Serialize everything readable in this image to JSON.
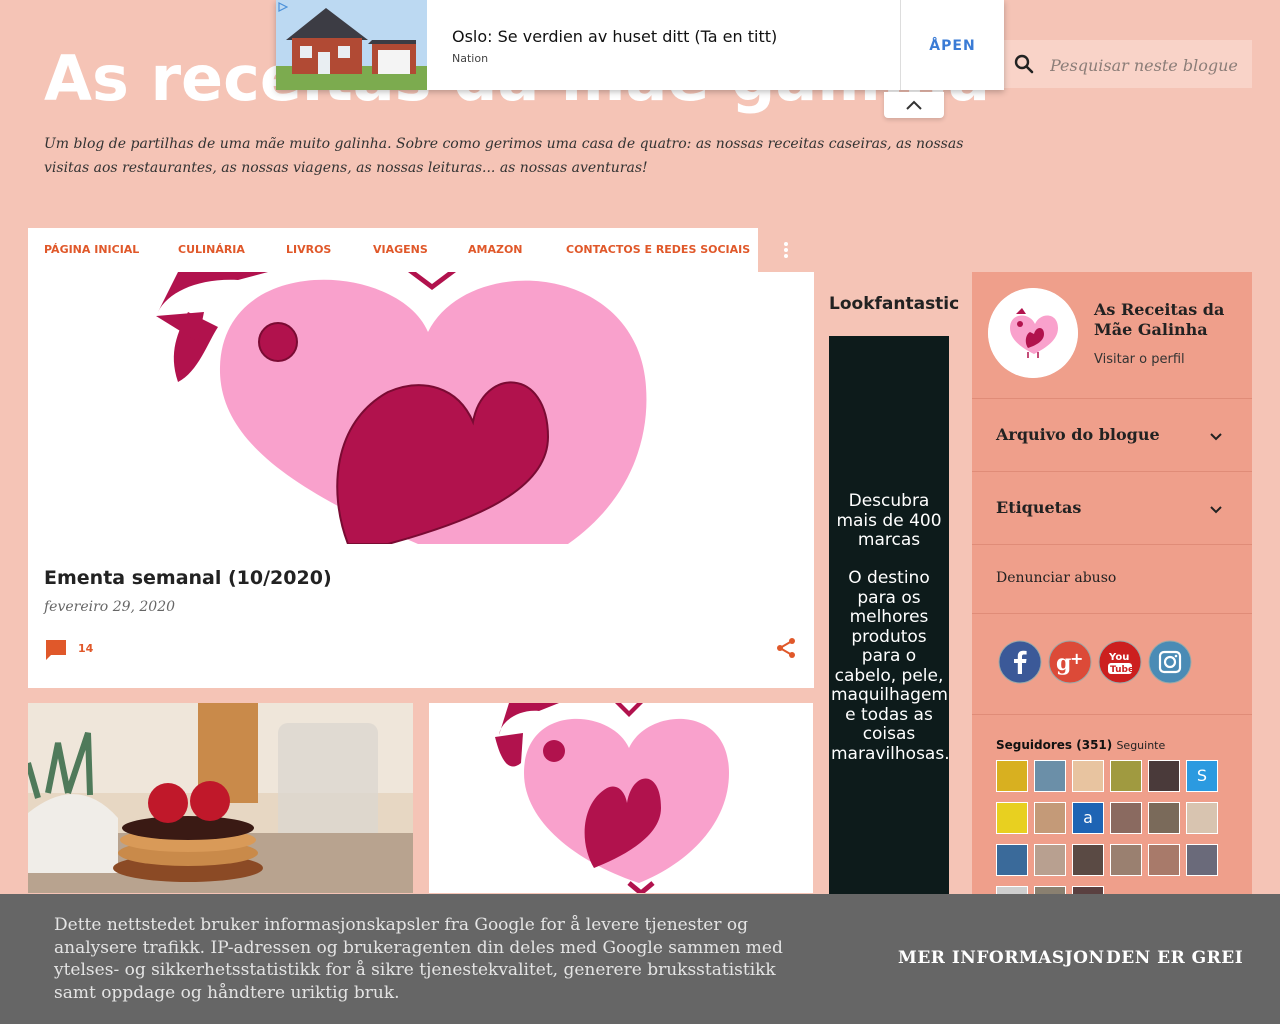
{
  "header": {
    "title": "As receitas da mãe galinha",
    "description": "Um blog de partilhas de uma mãe muito galinha. Sobre como gerimos uma casa de quatro: as nossas receitas caseiras, as nossas visitas aos restaurantes, as nossas viagens, as nossas leituras... as nossas aventuras!"
  },
  "search": {
    "placeholder": "Pesquisar neste blogue"
  },
  "ad": {
    "title": "Oslo: Se verdien av huset ditt (Ta en titt)",
    "source": "Nation",
    "cta": "ÅPEN"
  },
  "nav": {
    "items": [
      "PÁGINA INICIAL",
      "CULINÁRIA",
      "LIVROS",
      "VIAGENS",
      "AMAZON",
      "CONTACTOS E REDES SOCIAIS"
    ]
  },
  "post": {
    "title": "Ementa semanal (10/2020)",
    "date": "fevereiro 29, 2020",
    "comments": "14"
  },
  "side_ad": {
    "title": "Lookfantastic",
    "line1": "Descubra mais de 400 marcas",
    "line2": "O destino para os melhores produtos para o cabelo, pele, maquilhagem e todas as coisas maravilhosas."
  },
  "sidebar": {
    "profile_name": "As Receitas da Mãe Galinha",
    "profile_link": "Visitar o perfil",
    "archive": "Arquivo do blogue",
    "labels": "Etiquetas",
    "report": "Denunciar abuso",
    "followers_label": "Seguidores (351)",
    "follow_link": "Seguinte"
  },
  "cookie": {
    "text": "Dette nettstedet bruker informasjonskapsler fra Google for å levere tjenester og analysere trafikk. IP-adressen og brukeragenten din deles med Google sammen med ytelses- og sikkerhetsstatistikk for å sikre tjenestekvalitet, generere bruksstatistikk samt oppdage og håndtere uriktig bruk.",
    "more": "MER INFORMASJON",
    "ok": "DEN ER GREI"
  },
  "colors": {
    "background": "#f5c4b6",
    "accent": "#e0582a",
    "sidebar": "#ef9f8b",
    "cookie_bg": "#666666"
  }
}
